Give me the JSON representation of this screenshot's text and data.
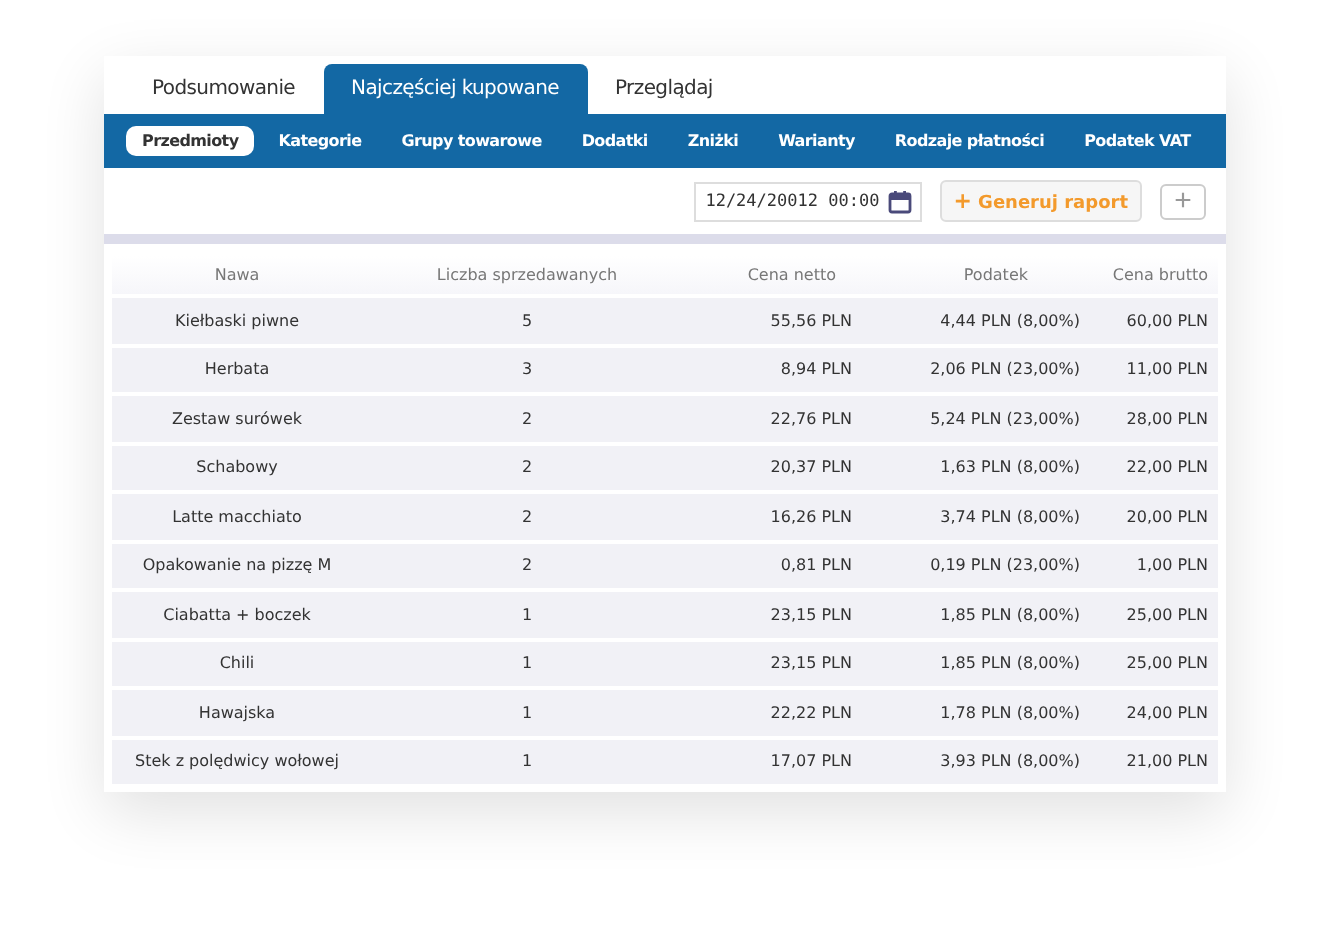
{
  "tabs": [
    {
      "label": "Podsumowanie",
      "selected": false
    },
    {
      "label": "Najczęściej kupowane",
      "selected": true
    },
    {
      "label": "Przeglądaj",
      "selected": false
    }
  ],
  "subtabs": [
    {
      "label": "Przedmioty",
      "selected": true
    },
    {
      "label": "Kategorie",
      "selected": false
    },
    {
      "label": "Grupy towarowe",
      "selected": false
    },
    {
      "label": "Dodatki",
      "selected": false
    },
    {
      "label": "Zniżki",
      "selected": false
    },
    {
      "label": "Warianty",
      "selected": false
    },
    {
      "label": "Rodzaje płatności",
      "selected": false
    },
    {
      "label": "Podatek VAT",
      "selected": false
    }
  ],
  "toolbar": {
    "date": "12/24/20012 00:00",
    "generate_button": "Generuj raport",
    "generate_icon": "+",
    "add_button": "+"
  },
  "table": {
    "columns": [
      "Nawa",
      "Liczba sprzedawanych",
      "Cena netto",
      "Podatek",
      "Cena brutto"
    ],
    "rows": [
      [
        "Kiełbaski piwne",
        "5",
        "55,56 PLN",
        "4,44 PLN (8,00%)",
        "60,00 PLN"
      ],
      [
        "Herbata",
        "3",
        "8,94 PLN",
        "2,06 PLN (23,00%)",
        "11,00 PLN"
      ],
      [
        "Zestaw surówek",
        "2",
        "22,76 PLN",
        "5,24 PLN (23,00%)",
        "28,00 PLN"
      ],
      [
        "Schabowy",
        "2",
        "20,37 PLN",
        "1,63 PLN (8,00%)",
        "22,00 PLN"
      ],
      [
        "Latte macchiato",
        "2",
        "16,26 PLN",
        "3,74 PLN (8,00%)",
        "20,00 PLN"
      ],
      [
        "Opakowanie na pizzę M",
        "2",
        "0,81 PLN",
        "0,19 PLN (23,00%)",
        "1,00 PLN"
      ],
      [
        "Ciabatta + boczek",
        "1",
        "23,15 PLN",
        "1,85 PLN (8,00%)",
        "25,00 PLN"
      ],
      [
        "Chili",
        "1",
        "23,15 PLN",
        "1,85 PLN (8,00%)",
        "25,00 PLN"
      ],
      [
        "Hawajska",
        "1",
        "22,22 PLN",
        "1,78 PLN (8,00%)",
        "24,00 PLN"
      ],
      [
        "Stek z polędwicy wołowej",
        "1",
        "17,07 PLN",
        "3,93 PLN (8,00%)",
        "21,00 PLN"
      ]
    ]
  }
}
